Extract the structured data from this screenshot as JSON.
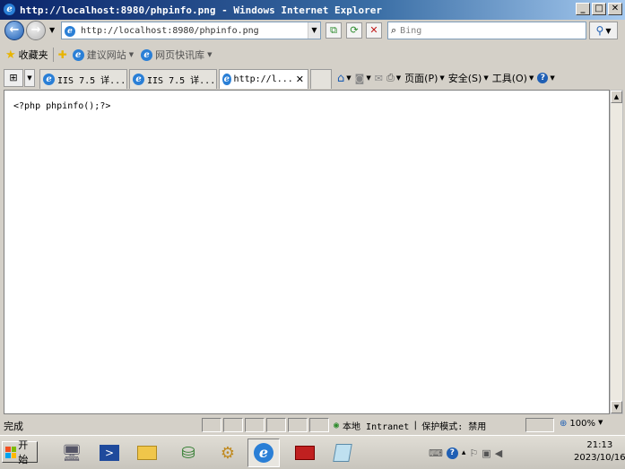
{
  "window": {
    "title": "http://localhost:8980/phpinfo.png - Windows Internet Explorer",
    "min": "_",
    "max": "□",
    "close": "✕"
  },
  "address": {
    "url": "http://localhost:8980/phpinfo.png",
    "search_placeholder": "Bing"
  },
  "favorites": {
    "label": "收藏夹",
    "items": [
      "建议网站",
      "网页快讯库"
    ]
  },
  "tabs": [
    {
      "label": "IIS 7.5 详...",
      "active": false
    },
    {
      "label": "IIS 7.5 详...",
      "active": false
    },
    {
      "label": "http://l...",
      "active": true
    }
  ],
  "commands": {
    "page": "页面(P)",
    "safety": "安全(S)",
    "tools": "工具(O)",
    "help": "?"
  },
  "content": {
    "text": "<?php phpinfo();?>"
  },
  "status": {
    "done": "完成",
    "zone": "本地 Intranet",
    "protected_mode": "保护模式: 禁用",
    "zoom": "100%"
  },
  "taskbar": {
    "start": "开始",
    "time": "21:13",
    "date": "2023/10/16"
  }
}
